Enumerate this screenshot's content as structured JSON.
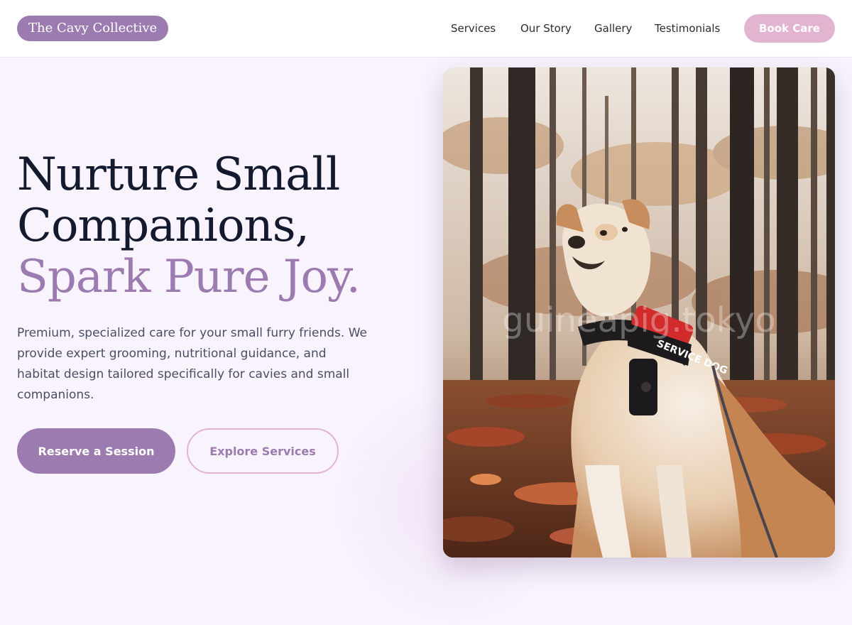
{
  "brand": {
    "name": "The Cavy Collective"
  },
  "nav": {
    "links": [
      "Services",
      "Our Story",
      "Gallery",
      "Testimonials"
    ],
    "cta_label": "Book Care"
  },
  "hero": {
    "headline_line1": "Nurture Small",
    "headline_line2": "Companions,",
    "headline_accent": "Spark Pure Joy.",
    "description": "Premium, specialized care for your small furry friends. We provide expert grooming, nutritional guidance, and habitat design tailored specifically for cavies and small companions.",
    "primary_cta": "Reserve a Session",
    "secondary_cta": "Explore Services"
  },
  "photo": {
    "harness_text": "SERVICE DOG",
    "watermark": "guineapig.tokyo"
  },
  "colors": {
    "accent": "#9b7bb0",
    "pink": "#e3b4cf",
    "background": "#f8f3fd",
    "heading": "#131a2e"
  }
}
